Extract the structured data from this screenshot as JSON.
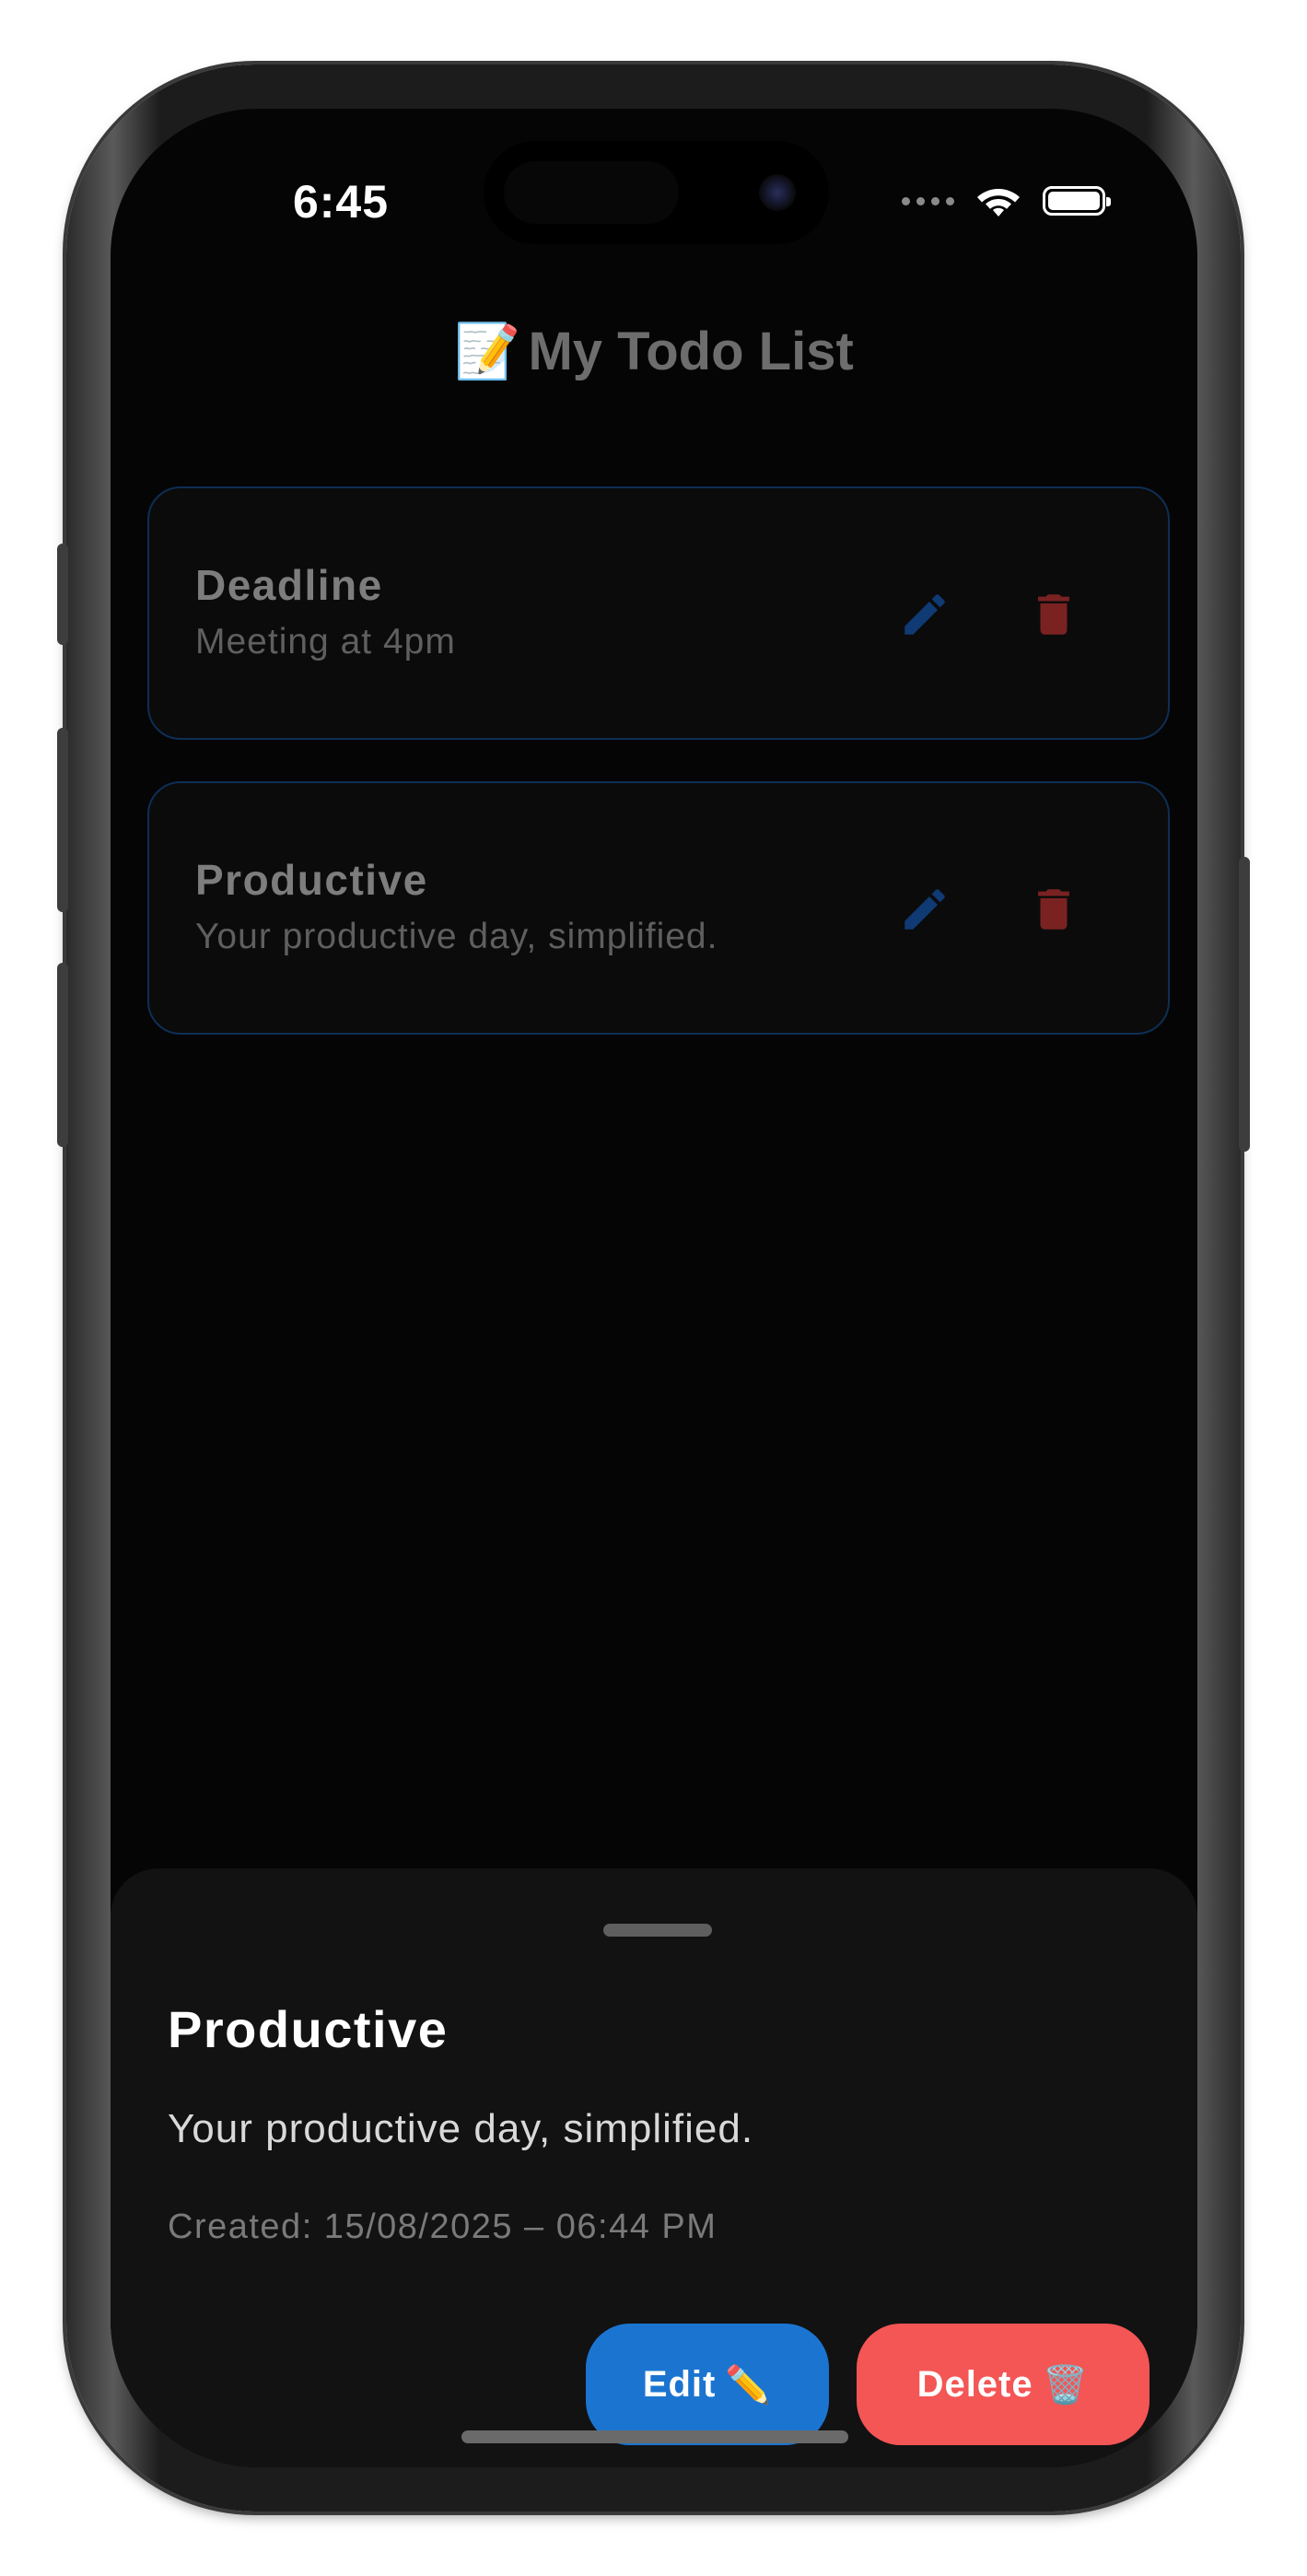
{
  "status_bar": {
    "time": "6:45"
  },
  "header": {
    "title_emoji": "📝",
    "title": "My Todo List"
  },
  "todos": [
    {
      "title": "Deadline",
      "description": "Meeting at 4pm"
    },
    {
      "title": "Productive",
      "description": "Your productive day, simplified."
    }
  ],
  "detail_sheet": {
    "title": "Productive",
    "description": "Your productive day, simplified.",
    "created": "Created: 15/08/2025 – 06:44 PM",
    "edit_label": "Edit",
    "edit_emoji": "✏️",
    "delete_label": "Delete",
    "delete_emoji": "🗑️"
  },
  "colors": {
    "accent_blue": "#1b75d0",
    "danger_red": "#f45555",
    "card_border": "#0e2e55",
    "edit_icon": "#0f3a73",
    "delete_icon": "#7a2222"
  },
  "icons": {
    "edit": "pencil-icon",
    "delete": "trash-icon"
  }
}
